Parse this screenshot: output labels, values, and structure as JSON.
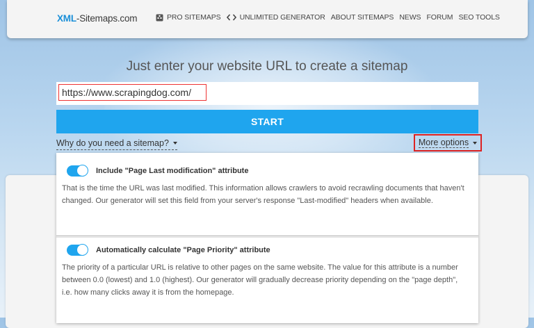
{
  "header": {
    "logo_brand": "XML",
    "logo_rest": "-Sitemaps.com",
    "nav": [
      {
        "label": "PRO SITEMAPS",
        "icon": "sitemap-icon"
      },
      {
        "label": "UNLIMITED GENERATOR",
        "icon": "code-icon"
      },
      {
        "label": "ABOUT SITEMAPS"
      },
      {
        "label": "NEWS"
      },
      {
        "label": "FORUM"
      },
      {
        "label": "SEO TOOLS"
      }
    ]
  },
  "main": {
    "headline": "Just enter your website URL to create a sitemap",
    "url_value": "https://www.scrapingdog.com/",
    "start_label": "START",
    "why_link": "Why do you need a sitemap?",
    "more_options": "More options"
  },
  "options": [
    {
      "title": "Include \"Page Last modification\" attribute",
      "enabled": true,
      "description": "That is the time the URL was last modified. This information allows crawlers to avoid recrawling documents that haven't changed. Our generator will set this field from your server's response \"Last-modified\" headers when available."
    },
    {
      "title": "Automatically calculate \"Page Priority\" attribute",
      "enabled": true,
      "description": "The priority of a particular URL is relative to other pages on the same website. The value for this attribute is a number between 0.0 (lowest) and 1.0 (highest). Our generator will gradually decrease priority depending on the \"page depth\", i.e. how many clicks away it is from the homepage."
    }
  ],
  "colors": {
    "accent": "#1fa5ee",
    "logo_blue": "#1a8fd8",
    "highlight_red": "#dd2222"
  }
}
